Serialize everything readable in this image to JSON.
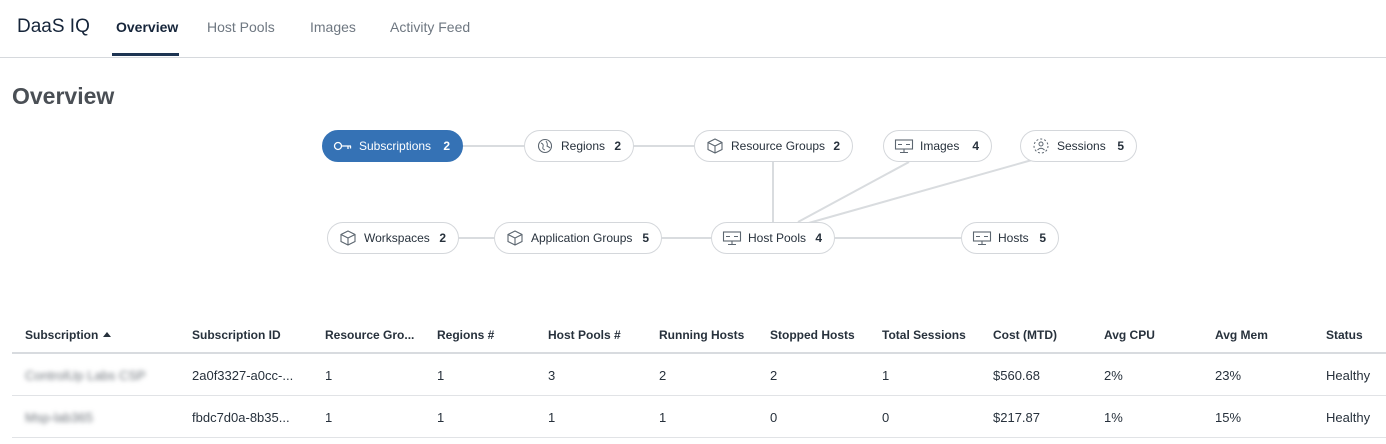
{
  "app": {
    "title": "DaaS IQ"
  },
  "tabs": [
    {
      "label": "Overview",
      "active": true
    },
    {
      "label": "Host Pools",
      "active": false
    },
    {
      "label": "Images",
      "active": false
    },
    {
      "label": "Activity Feed",
      "active": false
    }
  ],
  "page_title": "Overview",
  "graph": {
    "nodes": [
      {
        "label": "Subscriptions",
        "count": "2",
        "icon": "key-icon",
        "selected": true
      },
      {
        "label": "Regions",
        "count": "2",
        "icon": "globe-icon"
      },
      {
        "label": "Resource Groups",
        "count": "2",
        "icon": "cube-icon"
      },
      {
        "label": "Images",
        "count": "4",
        "icon": "monitor-icon"
      },
      {
        "label": "Sessions",
        "count": "5",
        "icon": "session-icon"
      },
      {
        "label": "Workspaces",
        "count": "2",
        "icon": "cube-icon"
      },
      {
        "label": "Application Groups",
        "count": "5",
        "icon": "cube-icon"
      },
      {
        "label": "Host Pools",
        "count": "4",
        "icon": "monitor-icon"
      },
      {
        "label": "Hosts",
        "count": "5",
        "icon": "monitor-icon"
      }
    ]
  },
  "table": {
    "columns": [
      "Subscription",
      "Subscription ID",
      "Resource Gro...",
      "Regions #",
      "Host Pools #",
      "Running Hosts",
      "Stopped Hosts",
      "Total Sessions",
      "Cost (MTD)",
      "Avg CPU",
      "Avg Mem",
      "Status"
    ],
    "rows": [
      [
        "ControlUp Labs CSP",
        "2a0f3327-a0cc-...",
        "1",
        "1",
        "3",
        "2",
        "2",
        "1",
        "$560.68",
        "2%",
        "23%",
        "Healthy"
      ],
      [
        "Msp-lab365",
        "fbdc7d0a-8b35...",
        "1",
        "1",
        "1",
        "1",
        "0",
        "0",
        "$217.87",
        "1%",
        "15%",
        "Healthy"
      ]
    ]
  },
  "colors": {
    "accent": "#3572b5",
    "nav_underline": "#1d3452"
  }
}
